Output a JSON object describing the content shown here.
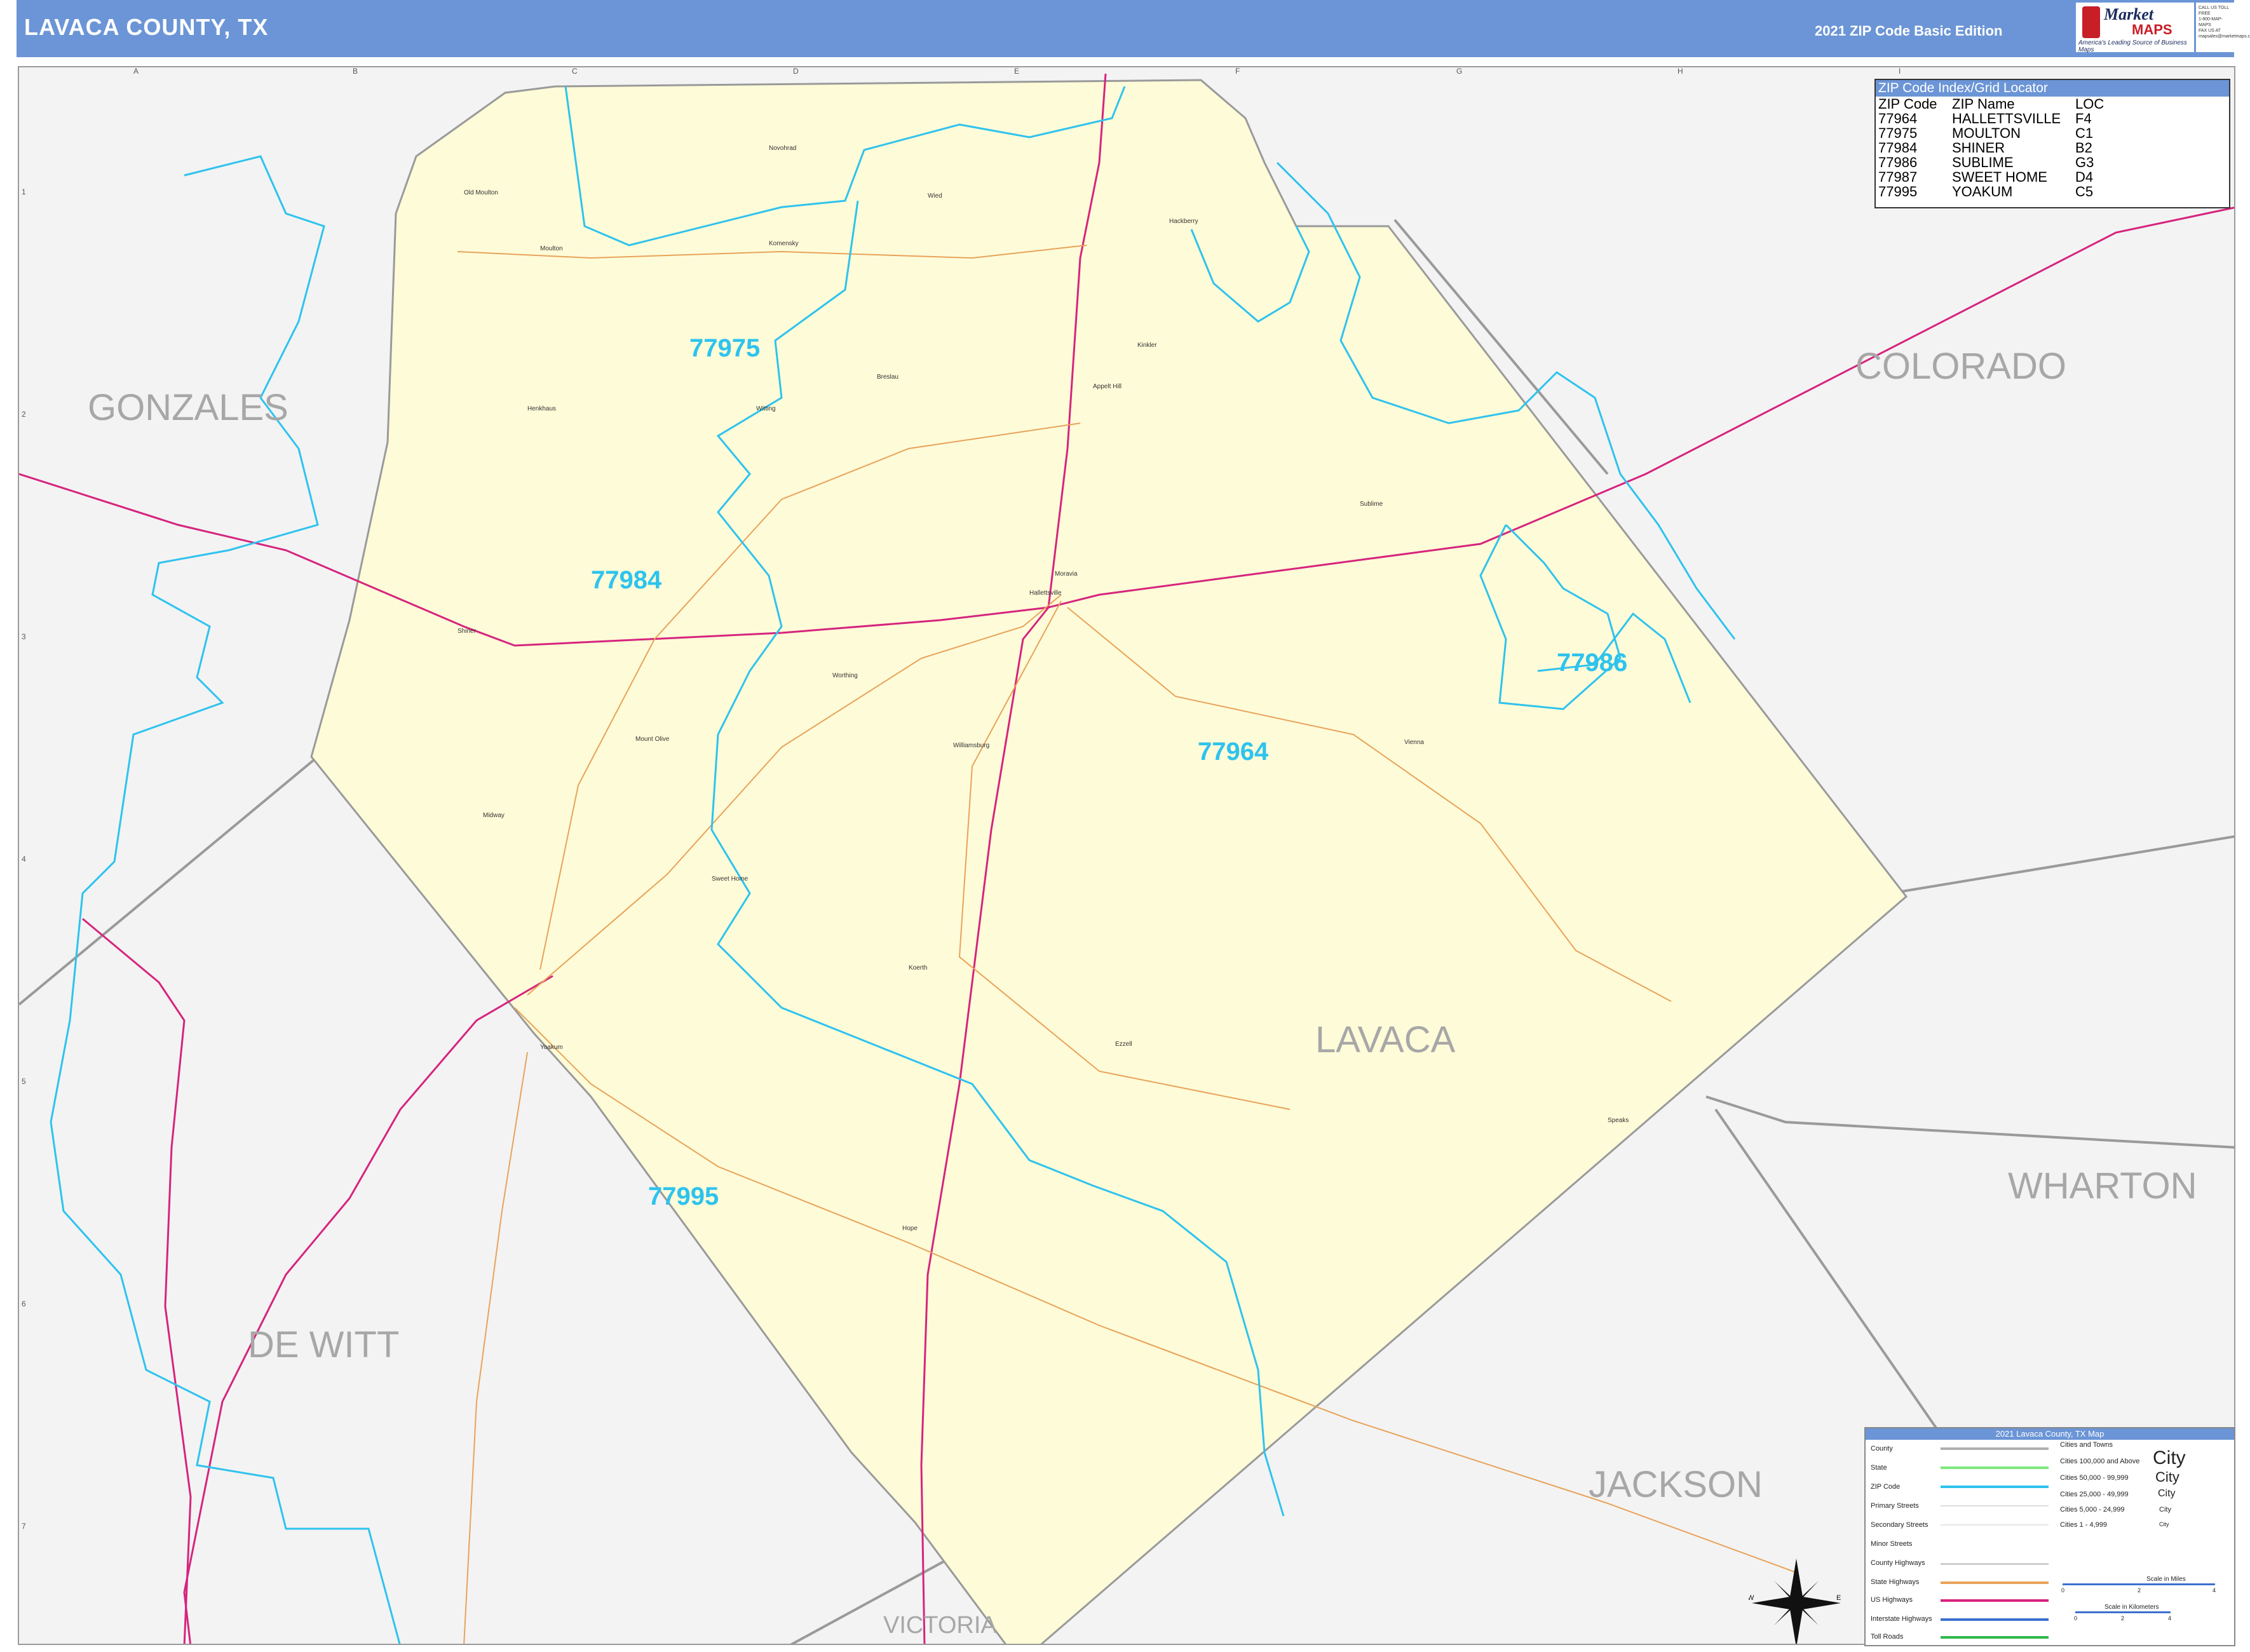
{
  "header": {
    "title": "LAVACA COUNTY, TX",
    "edition": "2021 ZIP Code Basic Edition",
    "logo": {
      "line1": "Market",
      "line2": "MAPS",
      "tagline": "America's Leading Source of Business Maps"
    },
    "contact": [
      "CALL US TOLL FREE",
      "1-800-MAP-MAPS",
      "FAX US AT",
      "mapsales@marketmaps.com"
    ]
  },
  "grid": {
    "columns": [
      "A",
      "B",
      "C",
      "D",
      "E",
      "F",
      "G",
      "H",
      "I"
    ],
    "rows": [
      "1",
      "2",
      "3",
      "4",
      "5",
      "6",
      "7"
    ]
  },
  "counties": {
    "gonzales": "GONZALES",
    "colorado": "COLORADO",
    "lavaca": "LAVACA",
    "wharton": "WHARTON",
    "dewitt": "DE WITT",
    "jackson": "JACKSON",
    "victoria": "VICTORIA"
  },
  "zip_labels": {
    "z77975": "77975",
    "z77984": "77984",
    "z77986": "77986",
    "z77964": "77964",
    "z77995": "77995"
  },
  "places": [
    "Old Moulton",
    "Moulton",
    "Novohrad",
    "Komensky",
    "Wied",
    "Hackberry",
    "Breslau",
    "Kinkler",
    "Appelt Hill",
    "Henkhaus",
    "Witting",
    "Sublime",
    "Hallettsville",
    "Shiner",
    "Moravia",
    "Worthing",
    "Williamsburg",
    "Mount Olive",
    "Vienna",
    "Midway",
    "Sweet Home",
    "Koerth",
    "Ezzell",
    "Speaks",
    "Yoakum",
    "Hope"
  ],
  "zip_index": {
    "title": "ZIP Code Index/Grid Locator",
    "headers": [
      "ZIP Code",
      "ZIP Name",
      "LOC"
    ],
    "rows": [
      [
        "77964",
        "HALLETTSVILLE",
        "F4"
      ],
      [
        "77975",
        "MOULTON",
        "C1"
      ],
      [
        "77984",
        "SHINER",
        "B2"
      ],
      [
        "77986",
        "SUBLIME",
        "G3"
      ],
      [
        "77987",
        "SWEET HOME",
        "D4"
      ],
      [
        "77995",
        "YOAKUM",
        "C5"
      ]
    ]
  },
  "legend": {
    "title": "2021 Lavaca County, TX Map",
    "items": [
      "County",
      "State",
      "ZIP Code",
      "Primary Streets",
      "Secondary Streets",
      "Minor Streets",
      "County Highways",
      "State Highways",
      "US Highways",
      "Interstate Highways",
      "Toll Roads"
    ],
    "cities_title": "Cities and Towns",
    "cities": [
      {
        "range": "Cities 100,000 and Above",
        "sample": "City"
      },
      {
        "range": "Cities 50,000 - 99,999",
        "sample": "City"
      },
      {
        "range": "Cities 25,000 - 49,999",
        "sample": "City"
      },
      {
        "range": "Cities 5,000 - 24,999",
        "sample": "City"
      },
      {
        "range": "Cities 1 - 4,999",
        "sample": "City"
      }
    ],
    "scale_miles": "Scale in Miles",
    "scale_km": "Scale in Kilometers",
    "scale_ticks": [
      "0",
      "2",
      "4"
    ]
  },
  "compass": {
    "n": "N",
    "s": "S",
    "e": "E",
    "w": "W"
  },
  "colors": {
    "header": "#6b95d6",
    "county_fill": "#fefbd8",
    "zip_line": "#2ec3ee",
    "us_highway": "#d6247e",
    "state_highway": "#e8a35a",
    "county_line": "#9a9a9a"
  }
}
